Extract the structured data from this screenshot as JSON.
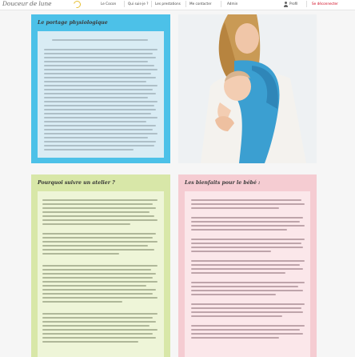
{
  "site": {
    "logo": "Douceur de lune"
  },
  "nav": {
    "items": [
      "Le Cocon",
      "Qui suis-je ?",
      "Les prestations",
      "Me contacter",
      "Admin"
    ],
    "profile": "Profil",
    "logout": "Se déconnecter"
  },
  "sections": {
    "portage": {
      "title": "Le portage physiologique"
    },
    "atelier": {
      "title": "Pourquoi suivre un atelier ?"
    },
    "bienfaits": {
      "title": "Les bienfaits pour le bébé :"
    }
  },
  "photo": {
    "subject": "mother-with-baby-in-blue-wrap"
  },
  "colors": {
    "portage_panel": "#4cc1e8",
    "atelier_panel": "#d8e7a8",
    "bienfaits_panel": "#f5ccd2",
    "logout": "#d0021b"
  }
}
